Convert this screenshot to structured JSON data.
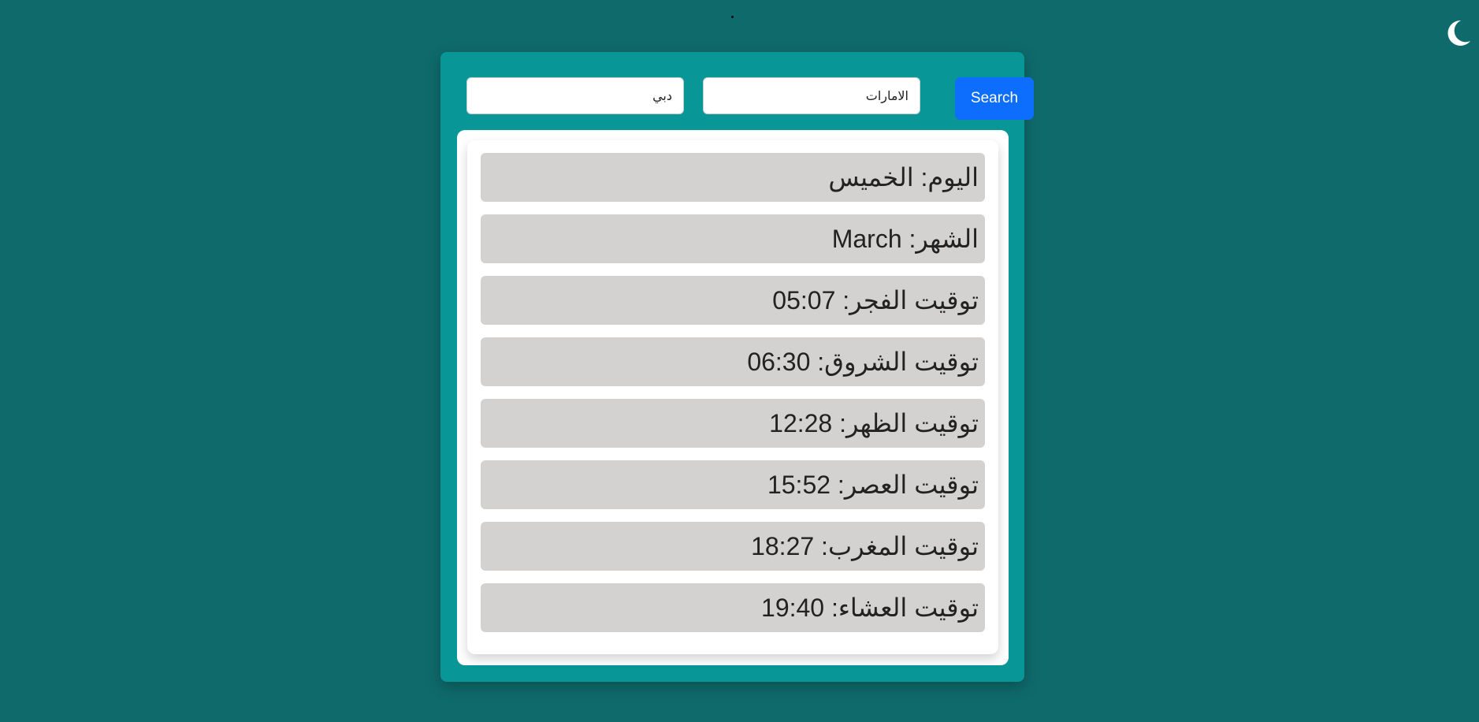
{
  "theme_toggle": {
    "icon": "moon-icon",
    "color": "#ffffff"
  },
  "search": {
    "city_value": "دبي",
    "country_value": "الامارات",
    "button_label": "Search"
  },
  "results": {
    "items": [
      {
        "label": "اليوم:",
        "value": "الخميس"
      },
      {
        "label": "الشهر:",
        "value": "March"
      },
      {
        "label": "توقيت الفجر:",
        "value": "05:07"
      },
      {
        "label": "توقيت الشروق:",
        "value": "06:30"
      },
      {
        "label": "توقيت الظهر:",
        "value": "12:28"
      },
      {
        "label": "توقيت العصر:",
        "value": "15:52"
      },
      {
        "label": "توقيت المغرب:",
        "value": "18:27"
      },
      {
        "label": "توقيت العشاء:",
        "value": "19:40"
      }
    ]
  },
  "colors": {
    "page_background": "#0f6a6b",
    "card_background": "#089696",
    "row_background": "#d3d2d1",
    "button_background": "#0d6efd"
  }
}
